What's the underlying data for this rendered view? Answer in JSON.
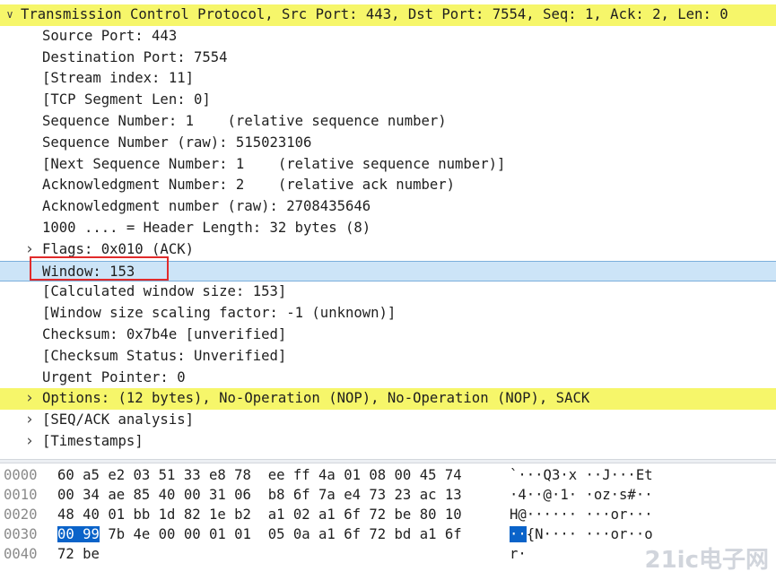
{
  "tree": {
    "rows": [
      {
        "text": "Transmission Control Protocol, Src Port: 443, Dst Port: 7554, Seq: 1, Ack: 2, Len: 0",
        "level": 0,
        "toggle": "expanded",
        "highlight": "yellow"
      },
      {
        "text": "Source Port: 443",
        "level": 1,
        "toggle": "none",
        "highlight": "none"
      },
      {
        "text": "Destination Port: 7554",
        "level": 1,
        "toggle": "none",
        "highlight": "none"
      },
      {
        "text": "[Stream index: 11]",
        "level": 1,
        "toggle": "none",
        "highlight": "none"
      },
      {
        "text": "[TCP Segment Len: 0]",
        "level": 1,
        "toggle": "none",
        "highlight": "none"
      },
      {
        "text": "Sequence Number: 1    (relative sequence number)",
        "level": 1,
        "toggle": "none",
        "highlight": "none"
      },
      {
        "text": "Sequence Number (raw): 515023106",
        "level": 1,
        "toggle": "none",
        "highlight": "none"
      },
      {
        "text": "[Next Sequence Number: 1    (relative sequence number)]",
        "level": 1,
        "toggle": "none",
        "highlight": "none"
      },
      {
        "text": "Acknowledgment Number: 2    (relative ack number)",
        "level": 1,
        "toggle": "none",
        "highlight": "none"
      },
      {
        "text": "Acknowledgment number (raw): 2708435646",
        "level": 1,
        "toggle": "none",
        "highlight": "none"
      },
      {
        "text": "1000 .... = Header Length: 32 bytes (8)",
        "level": 1,
        "toggle": "none",
        "highlight": "none"
      },
      {
        "text": "Flags: 0x010 (ACK)",
        "level": 1,
        "toggle": "collapsed",
        "highlight": "none"
      },
      {
        "text": "Window: 153",
        "level": 1,
        "toggle": "none",
        "highlight": "selected"
      },
      {
        "text": "[Calculated window size: 153]",
        "level": 1,
        "toggle": "none",
        "highlight": "none"
      },
      {
        "text": "[Window size scaling factor: -1 (unknown)]",
        "level": 1,
        "toggle": "none",
        "highlight": "none"
      },
      {
        "text": "Checksum: 0x7b4e [unverified]",
        "level": 1,
        "toggle": "none",
        "highlight": "none"
      },
      {
        "text": "[Checksum Status: Unverified]",
        "level": 1,
        "toggle": "none",
        "highlight": "none"
      },
      {
        "text": "Urgent Pointer: 0",
        "level": 1,
        "toggle": "none",
        "highlight": "none"
      },
      {
        "text": "Options: (12 bytes), No-Operation (NOP), No-Operation (NOP), SACK",
        "level": 1,
        "toggle": "collapsed",
        "highlight": "yellow"
      },
      {
        "text": "[SEQ/ACK analysis]",
        "level": 1,
        "toggle": "collapsed",
        "highlight": "none"
      },
      {
        "text": "[Timestamps]",
        "level": 1,
        "toggle": "collapsed",
        "highlight": "none"
      }
    ]
  },
  "hex": {
    "rows": [
      {
        "offset": "0000",
        "sel_bytes": "",
        "bytes": "60 a5 e2 03 51 33 e8 78  ee ff 4a 01 08 00 45 74",
        "sel_ascii": "",
        "ascii": "`···Q3·x ··J···Et"
      },
      {
        "offset": "0010",
        "sel_bytes": "",
        "bytes": "00 34 ae 85 40 00 31 06  b8 6f 7a e4 73 23 ac 13",
        "sel_ascii": "",
        "ascii": "·4··@·1· ·oz·s#··"
      },
      {
        "offset": "0020",
        "sel_bytes": "",
        "bytes": "48 40 01 bb 1d 82 1e b2  a1 02 a1 6f 72 be 80 10",
        "sel_ascii": "",
        "ascii": "H@······ ···or···"
      },
      {
        "offset": "0030",
        "sel_bytes": "00 99",
        "bytes": " 7b 4e 00 00 01 01  05 0a a1 6f 72 bd a1 6f",
        "sel_ascii": "··",
        "ascii": "{N···· ···or··o"
      },
      {
        "offset": "0040",
        "sel_bytes": "",
        "bytes": "72 be",
        "sel_ascii": "",
        "ascii": "r·"
      }
    ]
  },
  "watermark": {
    "text": "21ic电子网"
  },
  "colors": {
    "highlight_yellow": "#f6f66a",
    "selected_row": "#cce4f7",
    "annotation_box": "#e12b2b",
    "hex_selection": "#0a63c9"
  }
}
